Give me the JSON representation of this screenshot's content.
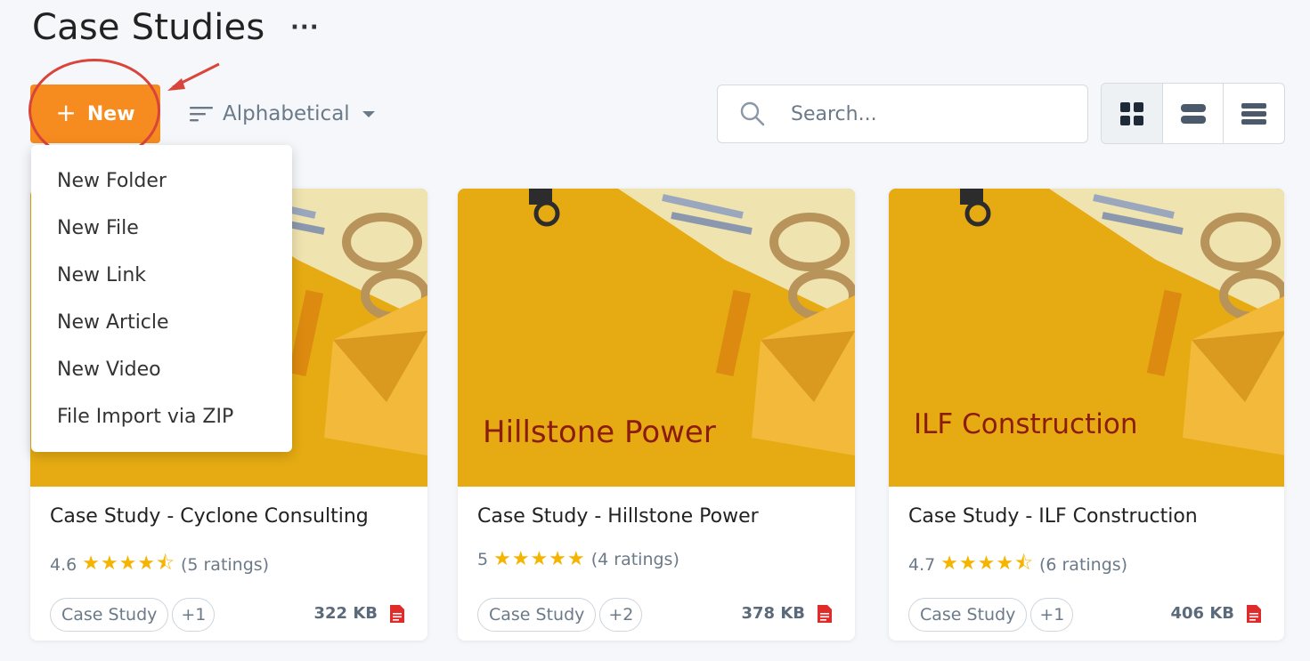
{
  "header": {
    "title": "Case Studies",
    "more_label": "···"
  },
  "toolbar": {
    "new_button_plus": "+",
    "new_button_label": "New",
    "sort_label": "Alphabetical",
    "search_placeholder": "Search...",
    "active_view": "grid"
  },
  "new_menu": {
    "items": [
      {
        "label": "New Folder"
      },
      {
        "label": "New File"
      },
      {
        "label": "New Link"
      },
      {
        "label": "New Article"
      },
      {
        "label": "New Video"
      },
      {
        "label": "File Import via ZIP"
      }
    ]
  },
  "colors": {
    "accent": "#f68b1f",
    "star": "#f5b400",
    "annotation": "#d9453a",
    "thumb_bg": "#e6ab13",
    "thumb_text": "#8a1c10"
  },
  "cards": [
    {
      "thumb_text": "",
      "title": "Case Study - Cyclone Consulting",
      "rating": "4.6",
      "stars": "★★★★⯪",
      "rating_count": "(5 ratings)",
      "tag": "Case Study",
      "tag_more": "+1",
      "size": "322 KB",
      "file_icon": "pdf-file-icon"
    },
    {
      "thumb_text": "Hillstone Power",
      "title": "Case Study - Hillstone Power",
      "rating": "5",
      "stars": "★★★★★",
      "rating_count": "(4 ratings)",
      "tag": "Case Study",
      "tag_more": "+2",
      "size": "378 KB",
      "file_icon": "pdf-file-icon"
    },
    {
      "thumb_text": "ILF Construction",
      "title": "Case Study - ILF Construction",
      "rating": "4.7",
      "stars": "★★★★⯪",
      "rating_count": "(6 ratings)",
      "tag": "Case Study",
      "tag_more": "+1",
      "size": "406 KB",
      "file_icon": "pdf-file-icon"
    }
  ]
}
